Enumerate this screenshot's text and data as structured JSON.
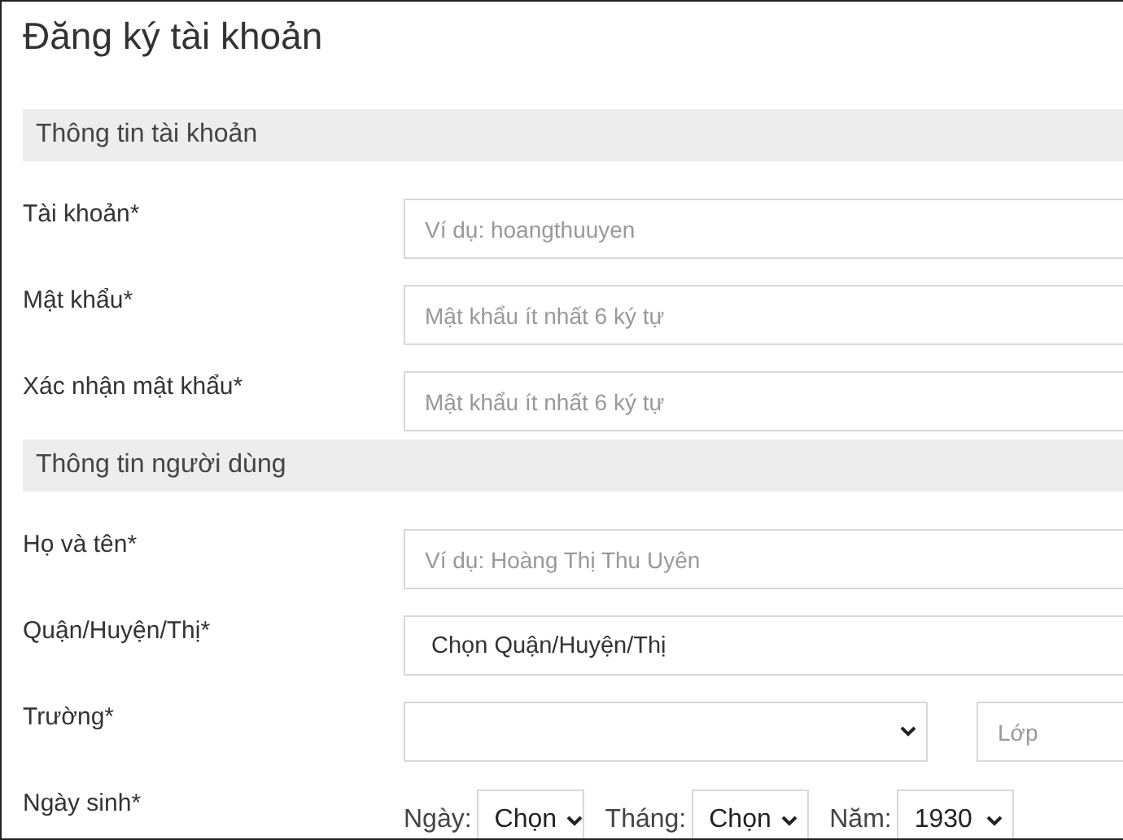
{
  "title": "Đăng ký tài khoản",
  "sections": [
    {
      "heading": "Thông tin tài khoản",
      "rows": [
        {
          "label": "Tài khoản*",
          "kind": "text",
          "placeholder": "Ví dụ: hoangthuuyen"
        },
        {
          "label": "Mật khẩu*",
          "kind": "text",
          "placeholder": "Mật khẩu ít nhất 6 ký tự"
        },
        {
          "label": "Xác nhận mật khẩu*",
          "kind": "text",
          "placeholder": "Mật khẩu ít nhất 6 ký tự"
        }
      ]
    },
    {
      "heading": "Thông tin người dùng",
      "rows": [
        {
          "label": "Họ và tên*",
          "kind": "text",
          "placeholder": "Ví dụ: Hoàng Thị Thu Uyên"
        },
        {
          "label": "Quận/Huyện/Thị*",
          "kind": "picker",
          "value": "Chọn Quận/Huyện/Thị"
        },
        {
          "label": "Trường*",
          "kind": "school",
          "placeholder": "Lớp"
        },
        {
          "label": "Ngày sinh*",
          "kind": "date",
          "parts": [
            {
              "label": "Ngày:",
              "value": "Chọn"
            },
            {
              "label": "Tháng:",
              "value": "Chọn"
            },
            {
              "label": "Năm:",
              "value": "1930"
            }
          ]
        }
      ]
    }
  ]
}
